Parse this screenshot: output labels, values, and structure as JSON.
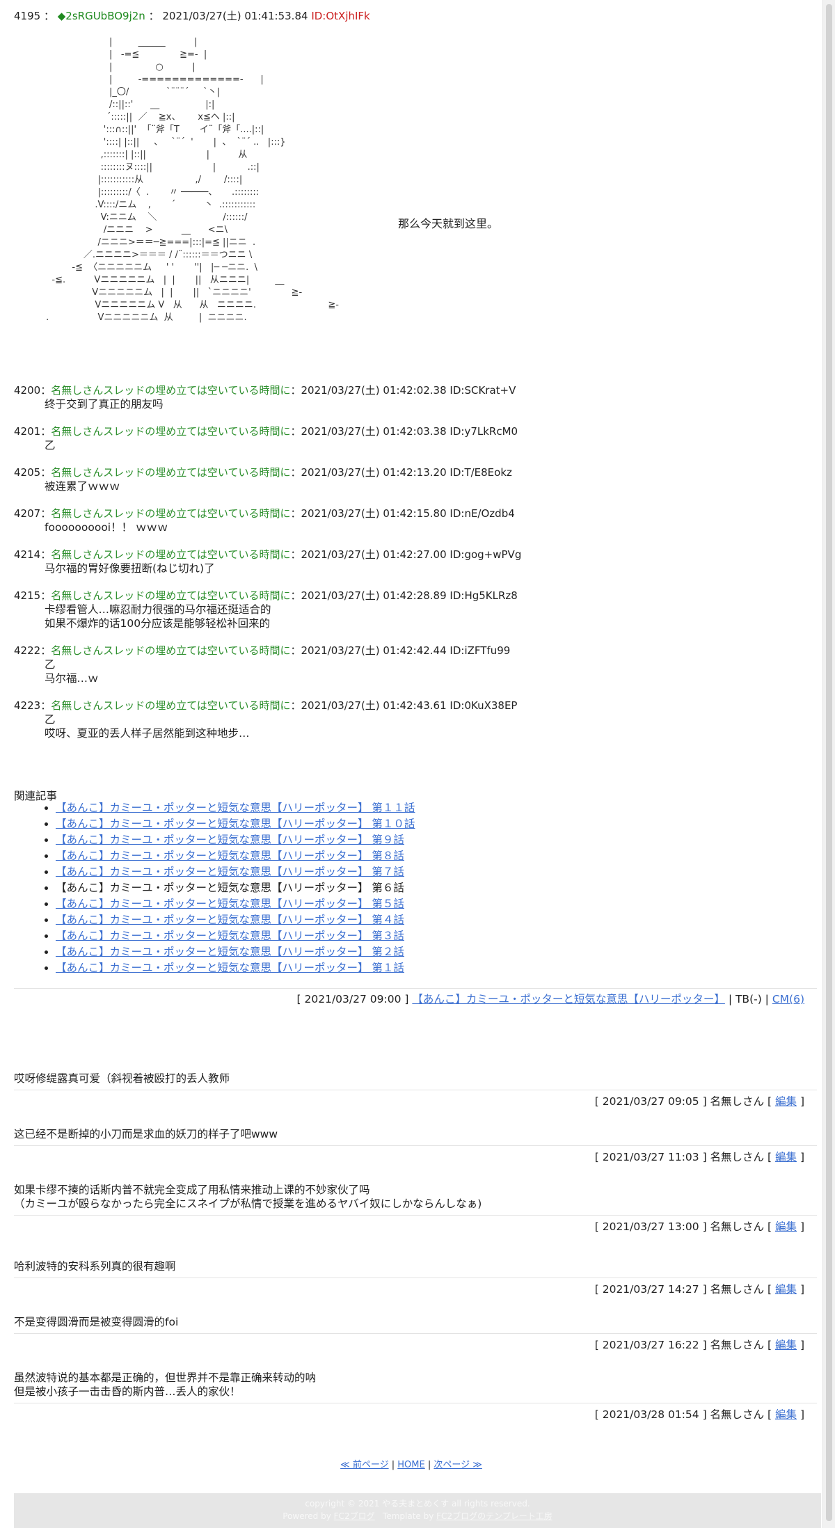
{
  "main_post": {
    "number": "4195",
    "sep": "：",
    "trip": "◆2sRGUbBO9j2n",
    "datetime": "2021/03/27(土) 01:41:53.84",
    "id": "ID:OtXjhIFk",
    "caption": "那么今天就到这里。",
    "aa": "                       |         ______          |\n                       |   -=≦              ≧=-  |\n                       |               ○          |\n                       |         -=============-      |\n                       |_〇/             `¨¨¨´     `丶|\n                       /::||::'      __                |:|\n                      ´:::::||  ／    ≧x、      x≦ヘ |::|\n                     ':::∩::||'  「¨斧「T       イ¨「斧「....|::|\n                     '::::| |::||     、   `¨´  '       |  、  `¨´ ..   |:::}\n                    ,:::::::| |::||                     |          从\n                    ::::::::ヌ::::||                     |           .::|\n                   |:::::::::::从                  ,/        /::::|\n                   |:::::::::/〈  .       〃 ─────、     .::::::::\n                  .V::::/ニム    ,       ´          丶  .:::::::::::\n                    V:ニニム    ＼                       /::::::/\n                     /ニニニ    >          __      <ニ\\\n                   /ニニニ>＝＝─≧===|:::|=≦ ||ニニ  .\n              ／.ニニニニ>＝＝＝ / /¨::::::＝＝つニニ \\\n          -≦  〈ニニニニニム     ' '       ''|   |─ ─ニニ.  \\\n   -≦.          Vニニニニニム   |  |       ||   从ニニニ|         __\n                 Vニニニニニム   |  |       ||   `ニニニニ'              ≧-\n                  Vニニニニニム V   从      从   ニニニニ.                         ≧-\n .                 Vニニニニニム  从         |  ニニニニ.",
    "aa_name": "ascii-art-illustration"
  },
  "replies": [
    {
      "number": "4200",
      "sep": "：",
      "name": "名無しさんスレッドの埋め立ては空いている時間に",
      "datetime": "2021/03/27(土) 01:42:02.38",
      "id": "ID:SCKrat+V",
      "lines": [
        "终于交到了真正的朋友吗"
      ]
    },
    {
      "number": "4201",
      "sep": "：",
      "name": "名無しさんスレッドの埋め立ては空いている時間に",
      "datetime": "2021/03/27(土) 01:42:03.38",
      "id": "ID:y7LkRcM0",
      "lines": [
        "乙"
      ]
    },
    {
      "number": "4205",
      "sep": "：",
      "name": "名無しさんスレッドの埋め立ては空いている時間に",
      "datetime": "2021/03/27(土) 01:42:13.20",
      "id": "ID:T/E8Eokz",
      "lines": [
        "被连累了ｗｗｗ"
      ]
    },
    {
      "number": "4207",
      "sep": "：",
      "name": "名無しさんスレッドの埋め立ては空いている時間に",
      "datetime": "2021/03/27(土) 01:42:15.80",
      "id": "ID:nE/Ozdb4",
      "lines": [
        "foooooooooi！！ ｗｗｗ"
      ]
    },
    {
      "number": "4214",
      "sep": "：",
      "name": "名無しさんスレッドの埋め立ては空いている時間に",
      "datetime": "2021/03/27(土) 01:42:27.00",
      "id": "ID:gog+wPVg",
      "lines": [
        "马尔福的胃好像要扭断(ねじ切れ)了"
      ]
    },
    {
      "number": "4215",
      "sep": "：",
      "name": "名無しさんスレッドの埋め立ては空いている時間に",
      "datetime": "2021/03/27(土) 01:42:28.89",
      "id": "ID:Hg5KLRz8",
      "lines": [
        "卡缪看管人…嘛忍耐力很强的马尔福还挺适合的",
        "如果不爆炸的话100分应该是能够轻松补回来的"
      ]
    },
    {
      "number": "4222",
      "sep": "：",
      "name": "名無しさんスレッドの埋め立ては空いている時間に",
      "datetime": "2021/03/27(土) 01:42:42.44",
      "id": "ID:iZFTfu99",
      "lines": [
        "乙",
        "马尔福…ｗ"
      ]
    },
    {
      "number": "4223",
      "sep": "：",
      "name": "名無しさんスレッドの埋め立ては空いている時間に",
      "datetime": "2021/03/27(土) 01:42:43.61",
      "id": "ID:0KuX38EP",
      "lines": [
        "乙",
        "哎呀、夏亚的丢人样子居然能到这种地步…"
      ]
    }
  ],
  "related": {
    "title": "関連記事",
    "items": [
      {
        "label": "【あんこ】カミーユ・ポッターと短気な意思【ハリーポッター】 第１１話",
        "link": true
      },
      {
        "label": "【あんこ】カミーユ・ポッターと短気な意思【ハリーポッター】 第１０話",
        "link": true
      },
      {
        "label": "【あんこ】カミーユ・ポッターと短気な意思【ハリーポッター】 第９話",
        "link": true
      },
      {
        "label": "【あんこ】カミーユ・ポッターと短気な意思【ハリーポッター】 第８話",
        "link": true
      },
      {
        "label": "【あんこ】カミーユ・ポッターと短気な意思【ハリーポッター】 第７話",
        "link": true
      },
      {
        "label": "【あんこ】カミーユ・ポッターと短気な意思【ハリーポッター】 第６話",
        "link": false
      },
      {
        "label": "【あんこ】カミーユ・ポッターと短気な意思【ハリーポッター】 第５話",
        "link": true
      },
      {
        "label": "【あんこ】カミーユ・ポッターと短気な意思【ハリーポッター】 第４話",
        "link": true
      },
      {
        "label": "【あんこ】カミーユ・ポッターと短気な意思【ハリーポッター】 第３話",
        "link": true
      },
      {
        "label": "【あんこ】カミーユ・ポッターと短気な意思【ハリーポッター】 第２話",
        "link": true
      },
      {
        "label": "【あんこ】カミーユ・ポッターと短気な意思【ハリーポッター】 第１話",
        "link": true
      }
    ]
  },
  "entry_meta": {
    "date_prefix": "[ 2021/03/27 09:00 ]",
    "category": "【あんこ】カミーユ・ポッターと短気な意思【ハリーポッター】",
    "tb": "| TB(-) |",
    "cm": "CM(6)"
  },
  "comments": [
    {
      "lines": [
        "哎呀修缇露真可爱（斜视着被殴打的丢人教师"
      ],
      "meta_prefix": "[ 2021/03/27 09:05 ] 名無しさん [",
      "edit": "編集",
      "meta_suffix": "]"
    },
    {
      "lines": [
        "这已经不是断掉的小刀而是求血的妖刀的样子了吧www"
      ],
      "meta_prefix": "[ 2021/03/27 11:03 ] 名無しさん [",
      "edit": "編集",
      "meta_suffix": "]"
    },
    {
      "lines": [
        "如果卡缪不揍的话斯内普不就完全变成了用私情来推动上课的不妙家伙了吗",
        "（カミーユが殴らなかったら完全にスネイプが私情で授業を進めるヤバイ奴にしかならんしなぁ)"
      ],
      "meta_prefix": "[ 2021/03/27 13:00 ] 名無しさん [",
      "edit": "編集",
      "meta_suffix": "]"
    },
    {
      "lines": [
        "哈利波特的安科系列真的很有趣啊"
      ],
      "meta_prefix": "[ 2021/03/27 14:27 ] 名無しさん [",
      "edit": "編集",
      "meta_suffix": "]"
    },
    {
      "lines": [
        "不是变得圆滑而是被变得圆滑的foi"
      ],
      "meta_prefix": "[ 2021/03/27 16:22 ] 名無しさん [",
      "edit": "編集",
      "meta_suffix": "]"
    },
    {
      "lines": [
        "虽然波特说的基本都是正确的，但世界并不是靠正确来转动的呐",
        "但是被小孩子一击击昏的斯内普…丢人的家伙！"
      ],
      "meta_prefix": "[ 2021/03/28 01:54 ] 名無しさん [",
      "edit": "編集",
      "meta_suffix": "]"
    }
  ],
  "pager": {
    "prev": "≪ 前ページ",
    "sep1": "|",
    "home": "HOME",
    "sep2": "|",
    "next": "次ページ ≫"
  },
  "footer": {
    "copyright": "copyright © 2021 やる夫まとめくす all rights reserved.",
    "powered_prefix": "Powered by",
    "powered_link": "FC2ブログ",
    "template_prefix": "Template by",
    "template_link": "FC2ブログのテンプレート工房"
  }
}
